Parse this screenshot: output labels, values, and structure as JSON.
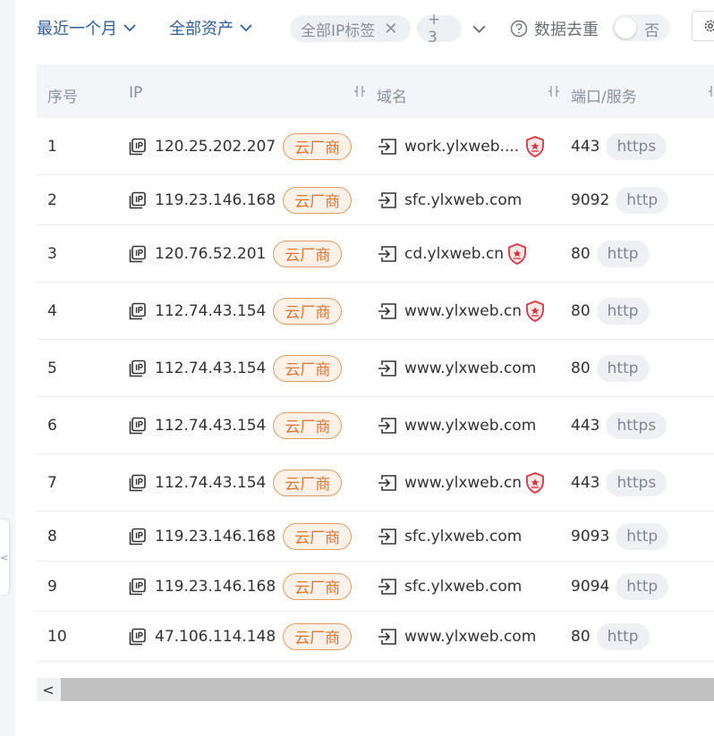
{
  "toolbar": {
    "time_filter": "最近一个月",
    "asset_filter": "全部资产",
    "ip_tag_filter": "全部IP标签",
    "more_tags": "+ 3",
    "dedupe_label": "数据去重",
    "dedupe_state": "否"
  },
  "table": {
    "columns": {
      "index": "序号",
      "ip": "IP",
      "domain": "域名",
      "port": "端口/服务"
    },
    "rows": [
      {
        "index": "1",
        "ip": "120.25.202.207",
        "tag": "云厂商",
        "domain": "work.ylxweb....",
        "shield": true,
        "port": "443",
        "service": "https"
      },
      {
        "index": "2",
        "ip": "119.23.146.168",
        "tag": "云厂商",
        "domain": "sfc.ylxweb.com",
        "shield": false,
        "port": "9092",
        "service": "http"
      },
      {
        "index": "3",
        "ip": "120.76.52.201",
        "tag": "云厂商",
        "domain": "cd.ylxweb.cn",
        "shield": true,
        "port": "80",
        "service": "http"
      },
      {
        "index": "4",
        "ip": "112.74.43.154",
        "tag": "云厂商",
        "domain": "www.ylxweb.cn",
        "shield": true,
        "port": "80",
        "service": "http"
      },
      {
        "index": "5",
        "ip": "112.74.43.154",
        "tag": "云厂商",
        "domain": "www.ylxweb.com",
        "shield": false,
        "port": "80",
        "service": "http"
      },
      {
        "index": "6",
        "ip": "112.74.43.154",
        "tag": "云厂商",
        "domain": "www.ylxweb.com",
        "shield": false,
        "port": "443",
        "service": "https"
      },
      {
        "index": "7",
        "ip": "112.74.43.154",
        "tag": "云厂商",
        "domain": "www.ylxweb.cn",
        "shield": true,
        "port": "443",
        "service": "https"
      },
      {
        "index": "8",
        "ip": "119.23.146.168",
        "tag": "云厂商",
        "domain": "sfc.ylxweb.com",
        "shield": false,
        "port": "9093",
        "service": "http"
      },
      {
        "index": "9",
        "ip": "119.23.146.168",
        "tag": "云厂商",
        "domain": "sfc.ylxweb.com",
        "shield": false,
        "port": "9094",
        "service": "http"
      },
      {
        "index": "10",
        "ip": "47.106.114.148",
        "tag": "云厂商",
        "domain": "www.ylxweb.com",
        "shield": false,
        "port": "80",
        "service": "http"
      }
    ]
  },
  "sidebar_toggle": "<",
  "scroll_left": "<",
  "colors": {
    "accent": "#2f5e9c",
    "tag_orange": "#e07632",
    "shield_red": "#d9363e"
  },
  "icons": [
    "chevron-down-icon",
    "close-icon",
    "question-circle-icon",
    "gear-icon",
    "column-sort-icon",
    "ip-icon",
    "link-icon",
    "shield-icon"
  ]
}
